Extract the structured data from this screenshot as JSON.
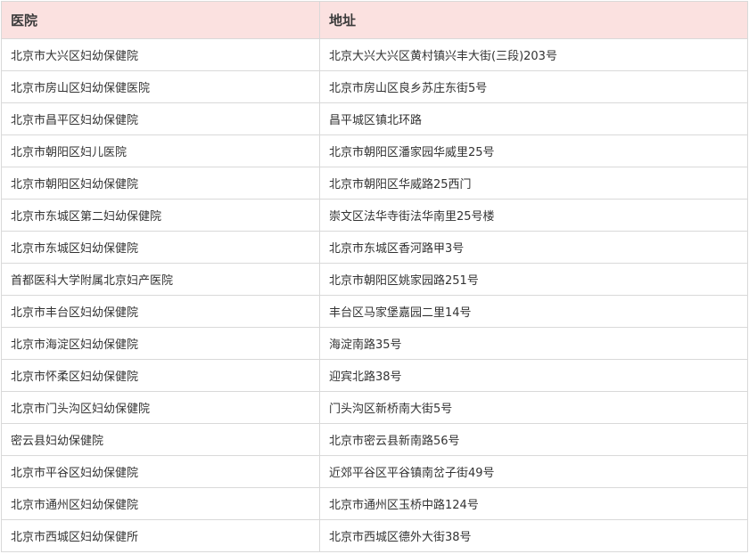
{
  "table": {
    "headers": {
      "hospital": "医院",
      "address": "地址"
    },
    "rows": [
      {
        "hospital": "北京市大兴区妇幼保健院",
        "address": "北京大兴大兴区黄村镇兴丰大街(三段)203号"
      },
      {
        "hospital": "北京市房山区妇幼保健医院",
        "address": "北京市房山区良乡苏庄东街5号"
      },
      {
        "hospital": "北京市昌平区妇幼保健院",
        "address": "昌平城区镇北环路"
      },
      {
        "hospital": "北京市朝阳区妇儿医院",
        "address": "北京市朝阳区潘家园华威里25号"
      },
      {
        "hospital": "北京市朝阳区妇幼保健院",
        "address": "北京市朝阳区华威路25西门"
      },
      {
        "hospital": "北京市东城区第二妇幼保健院",
        "address": "崇文区法华寺街法华南里25号楼"
      },
      {
        "hospital": "北京市东城区妇幼保健院",
        "address": "北京市东城区香河路甲3号"
      },
      {
        "hospital": "首都医科大学附属北京妇产医院",
        "address": "北京市朝阳区姚家园路251号"
      },
      {
        "hospital": "北京市丰台区妇幼保健院",
        "address": "丰台区马家堡嘉园二里14号"
      },
      {
        "hospital": "北京市海淀区妇幼保健院",
        "address": "海淀南路35号"
      },
      {
        "hospital": "北京市怀柔区妇幼保健院",
        "address": "迎宾北路38号"
      },
      {
        "hospital": "北京市门头沟区妇幼保健院",
        "address": "门头沟区新桥南大街5号"
      },
      {
        "hospital": "密云县妇幼保健院",
        "address": "北京市密云县新南路56号"
      },
      {
        "hospital": "北京市平谷区妇幼保健院",
        "address": "近郊平谷区平谷镇南岔子街49号"
      },
      {
        "hospital": "北京市通州区妇幼保健院",
        "address": "北京市通州区玉桥中路124号"
      },
      {
        "hospital": "北京市西城区妇幼保健所",
        "address": "北京市西城区德外大街38号"
      }
    ]
  }
}
